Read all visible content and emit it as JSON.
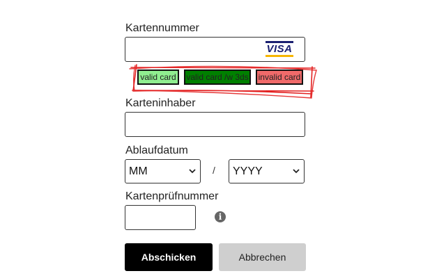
{
  "form": {
    "card_number_label": "Kartennummer",
    "card_number_value": "",
    "card_brand": "VISA",
    "card_holder_label": "Karteninhaber",
    "card_holder_value": "",
    "expiry_label": "Ablaufdatum",
    "expiry_month": "MM",
    "expiry_separator": "/",
    "expiry_year": "YYYY",
    "cvc_label": "Kartenprüfnummer",
    "cvc_value": "",
    "info_glyph": "i"
  },
  "test_cards": [
    {
      "label": "valid card",
      "color": "#90ee90"
    },
    {
      "label": "valid card /w 3ds",
      "color": "#008000"
    },
    {
      "label": "invalid card",
      "color": "#f06a6a"
    }
  ],
  "actions": {
    "submit_label": "Abschicken",
    "cancel_label": "Abbrechen"
  },
  "colors": {
    "annotation": "#e32222",
    "primary": "#000000",
    "secondary": "#cfcfcf"
  }
}
